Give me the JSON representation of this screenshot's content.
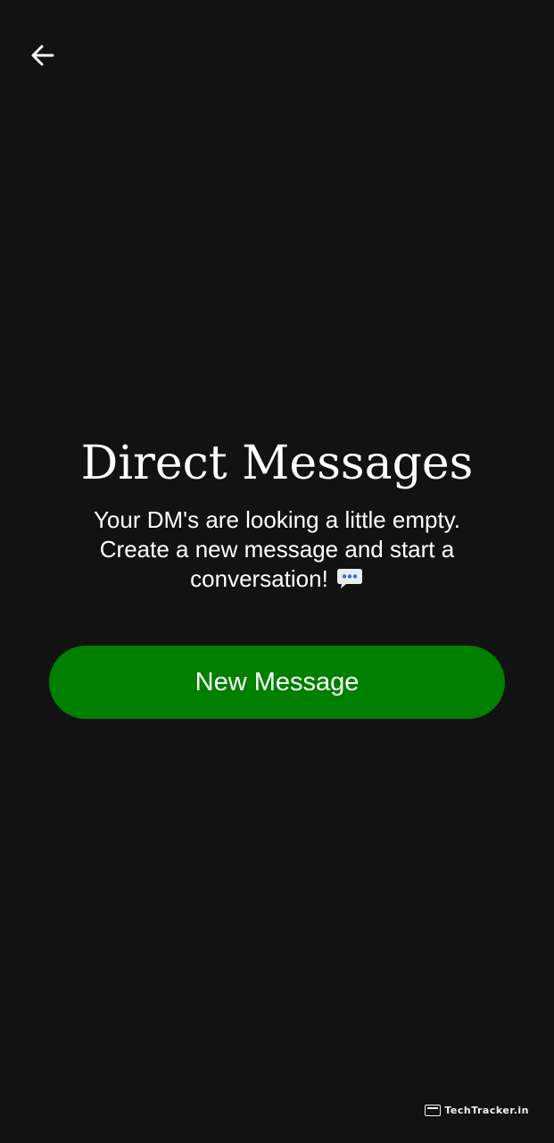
{
  "header": {
    "back_icon": "arrow-left-icon"
  },
  "empty_state": {
    "title": "Direct Messages",
    "message": "Your DM's are looking a little empty. Create a new message and start a conversation!",
    "emoji_icon": "speech-bubble-icon"
  },
  "actions": {
    "new_message_label": "New Message",
    "button_color": "#007f00"
  },
  "watermark": {
    "text": "TechTracker.in",
    "icon": "techtracker-logo-icon"
  },
  "theme": {
    "background": "#121212",
    "text": "#ffffff"
  }
}
